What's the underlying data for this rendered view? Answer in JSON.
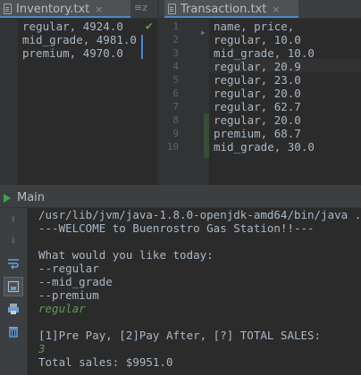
{
  "left_tab": {
    "title": "Inventory.txt",
    "close": "×",
    "menu_icon": "≡z"
  },
  "inventory_lines": [
    "regular, 4924.0",
    "mid_grade, 4981.0",
    "premium, 4970.0"
  ],
  "right_tab": {
    "title": "Transaction.txt",
    "close": "×"
  },
  "transaction_line_numbers": [
    "1",
    "2",
    "3",
    "4",
    "5",
    "6",
    "7",
    "8",
    "9",
    "10"
  ],
  "transaction_lines": [
    "name, price,",
    "regular, 10.0",
    "mid_grade, 10.0",
    "regular, 20.9",
    "regular, 23.0",
    "regular, 20.0",
    "regular, 62.7",
    "regular, 20.0",
    "premium, 68.7",
    "mid_grade, 30.0"
  ],
  "run_panel": {
    "title": "Main"
  },
  "console": {
    "command": "/usr/lib/jvm/java-1.8.0-openjdk-amd64/bin/java ...",
    "welcome": "---WELCOME to Buenrostro Gas Station!!---",
    "prompt": "What would you like today:",
    "option1": "--regular",
    "option2": "--mid_grade",
    "option3": "--premium",
    "input1": "regular",
    "prompt2": "[1]Pre Pay, [2]Pay After, [?] TOTAL SALES:",
    "input2": "3",
    "result": "Total sales: $9951.0"
  },
  "colors": {
    "accent": "#4a88c7",
    "user_input": "#629755",
    "background": "#2b2b2b"
  }
}
